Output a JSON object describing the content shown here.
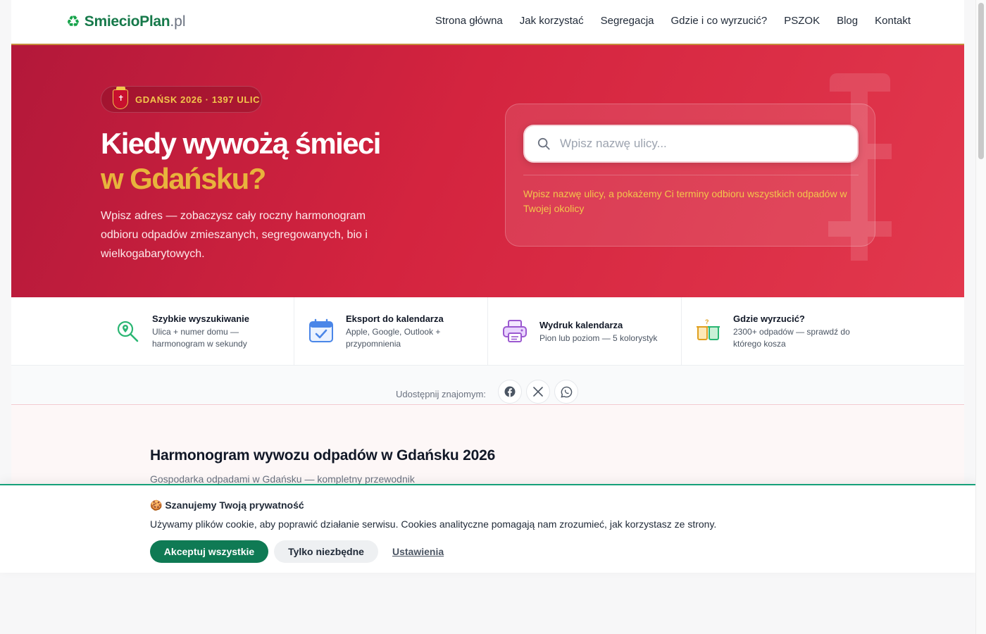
{
  "header": {
    "logo_brand": "SmiecioPlan",
    "logo_tld": ".pl",
    "nav": [
      "Strona główna",
      "Jak korzystać",
      "Segregacja",
      "Gdzie i co wyrzucić?",
      "PSZOK",
      "Blog",
      "Kontakt"
    ]
  },
  "hero": {
    "badge": "GDAŃSK 2026 · 1397 ULIC",
    "title_line1": "Kiedy wywożą śmieci",
    "title_line2": "w Gdańsku?",
    "lead": "Wpisz adres — zobaczysz cały roczny harmonogram odbioru odpadów zmieszanych, segregowanych, bio i wielkogabarytowych.",
    "search_placeholder": "Wpisz nazwę ulicy...",
    "search_hint": "Wpisz nazwę ulicy, a pokażemy Ci terminy odbioru wszystkich odpadów w Twojej okolicy"
  },
  "features": [
    {
      "icon": "map-pin-search-icon",
      "title": "Szybkie wyszukiwanie",
      "desc_lines": [
        "Ulica + numer domu —",
        "harmonogram w sekundy"
      ]
    },
    {
      "icon": "calendar-check-icon",
      "title": "Eksport do kalendarza",
      "desc_lines": [
        "Apple, Google, Outlook +",
        "przypomnienia"
      ]
    },
    {
      "icon": "printer-icon",
      "title": "Wydruk kalendarza",
      "desc_lines": [
        "Pion lub poziom — 5 kolorystyk"
      ]
    },
    {
      "icon": "bins-question-icon",
      "title": "Gdzie wyrzucić?",
      "desc_lines": [
        "2300+ odpadów — sprawdź do",
        "którego kosza"
      ]
    }
  ],
  "share": {
    "label": "Udostępnij znajomym:",
    "buttons": [
      "facebook-icon",
      "x-icon",
      "whatsapp-icon"
    ]
  },
  "content": {
    "heading": "Harmonogram wywozu odpadów w Gdańsku 2026",
    "subheading": "Gospodarka odpadami w Gdańsku — kompletny przewodnik"
  },
  "cookie": {
    "title": "Szanujemy Twoją prywatność",
    "text": "Używamy plików cookie, aby poprawić działanie serwisu. Cookies analityczne pomagają nam zrozumieć, jak korzystasz ze strony.",
    "accept_label": "Akceptuj wszystkie",
    "essential_label": "Tylko niezbędne",
    "settings_label": "Ustawienia"
  },
  "colors": {
    "brand_green": "#16794a",
    "hero_red": "#d4243f",
    "accent_gold": "#e8b33c",
    "accept_green": "#0f7a54"
  }
}
